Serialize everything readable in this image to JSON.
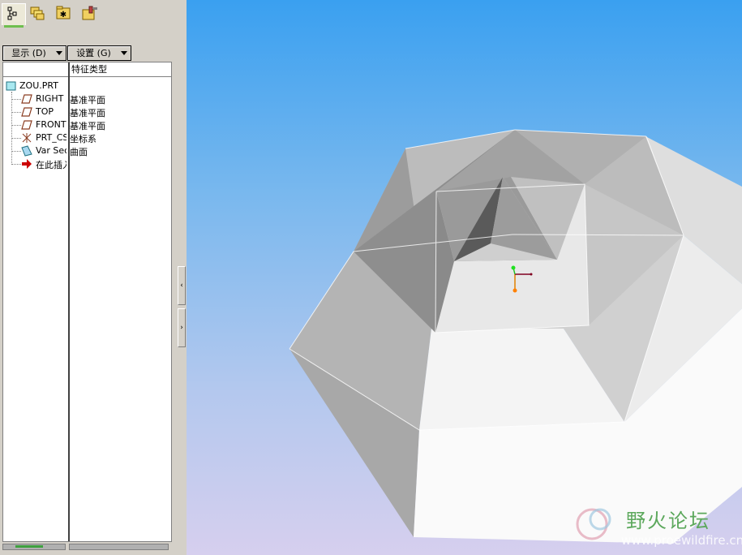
{
  "tabs": [
    {
      "icon": "model-tree-icon",
      "active": true
    },
    {
      "icon": "folder-browser-icon",
      "active": false
    },
    {
      "icon": "favorites-icon",
      "active": false
    },
    {
      "icon": "connections-icon",
      "active": false
    }
  ],
  "toolbar": {
    "show_label": "显示 (D)",
    "settings_label": "设置 (G)"
  },
  "tree": {
    "column_header": "特征类型",
    "root": {
      "name": "ZOU.PRT",
      "icon": "part-icon"
    },
    "items": [
      {
        "name": "RIGHT",
        "type": "基准平面",
        "icon": "datum-plane-icon"
      },
      {
        "name": "TOP",
        "type": "基准平面",
        "icon": "datum-plane-icon"
      },
      {
        "name": "FRONT",
        "type": "基准平面",
        "icon": "datum-plane-icon"
      },
      {
        "name": "PRT_CSYS_DEF",
        "type": "坐标系",
        "icon": "coordinate-system-icon"
      },
      {
        "name": "Var Sect Sweep",
        "type": "曲面",
        "icon": "surface-icon"
      },
      {
        "name": "在此插入",
        "type": "",
        "icon": "insert-here-arrow-icon"
      }
    ]
  },
  "watermark": {
    "title": "野火论坛",
    "url": "www.proewildfire.cn"
  },
  "colors": {
    "panel": "#d4d0c8",
    "viewport_top": "#3aa0f0",
    "viewport_bottom": "#d6cfee",
    "insert_arrow": "#cc0000"
  }
}
